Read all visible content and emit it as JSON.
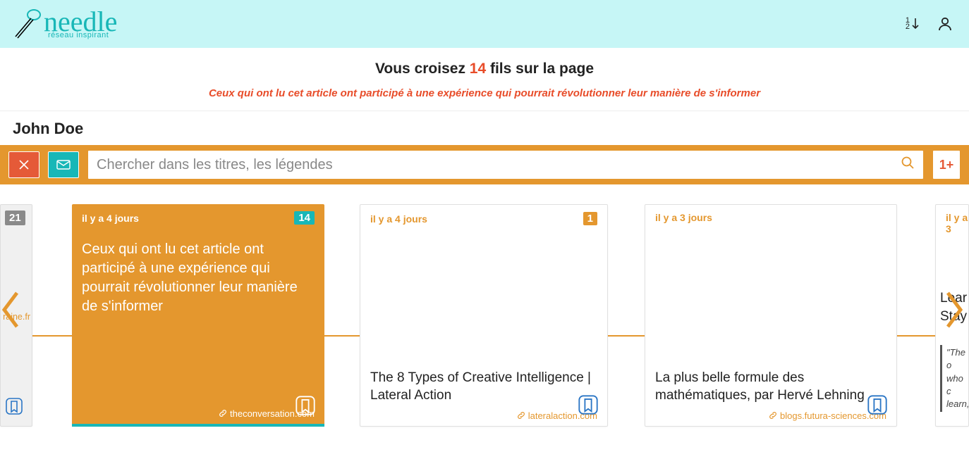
{
  "brand": {
    "name": "needle",
    "subtitle": "réseau inspirant"
  },
  "header": {
    "line_prefix": "Vous croisez ",
    "count": "14",
    "line_suffix": " fils sur la page",
    "tagline": "Ceux qui ont lu cet article ont participé à une expérience qui pourrait révolutionner leur manière de s'informer"
  },
  "user": {
    "name": "John Doe"
  },
  "search": {
    "placeholder": "Chercher dans les titres, les légendes"
  },
  "corner_badge": "1+",
  "frag_left": {
    "badge": "21",
    "source": "raine.fr"
  },
  "cards": [
    {
      "time": "il y a 4 jours",
      "badge": "14",
      "title": "Ceux qui ont lu cet article ont participé à une expérience qui pourrait révolutionner leur manière de s'informer",
      "source": "theconversation.com"
    },
    {
      "time": "il y a 4 jours",
      "badge": "1",
      "title": "The 8 Types of Creative Intelligence | Lateral Action",
      "source": "lateralaction.com"
    },
    {
      "time": "il y a 3 jours",
      "badge": "",
      "title": "La plus belle formule des mathématiques, par Hervé Lehning",
      "source": "blogs.futura-sciences.com"
    }
  ],
  "frag_right": {
    "time": "il y a 3",
    "title_line1": "Lear",
    "title_line2": "Stay",
    "quote": "\"The o\nwho c\nlearn,"
  }
}
